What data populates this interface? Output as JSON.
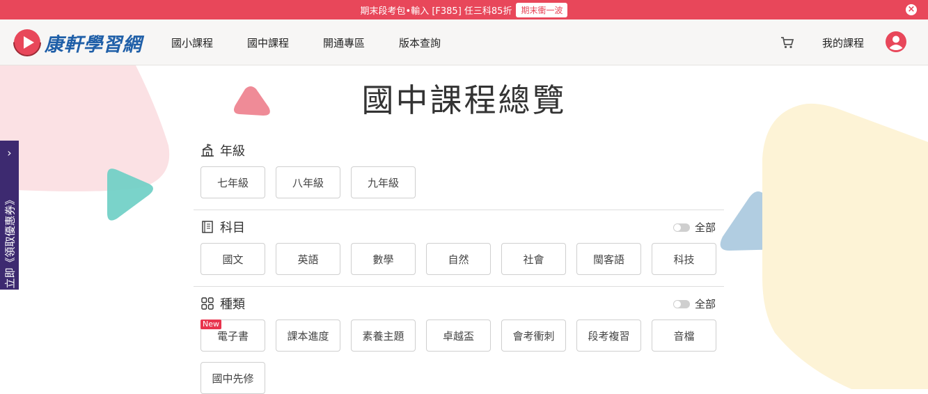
{
  "promo": {
    "text": "期末段考包•輸入 [F385] 任三科85折",
    "button": "期末衝一波"
  },
  "header": {
    "logo_text": "康軒學習網",
    "nav": [
      "國小課程",
      "國中課程",
      "開通專區",
      "版本查詢"
    ],
    "my_course": "我的課程"
  },
  "side_tab": {
    "text": "立即《領取優惠券》"
  },
  "page": {
    "title": "國中課程總覽"
  },
  "grade": {
    "label": "年級",
    "options": [
      "七年級",
      "八年級",
      "九年級"
    ]
  },
  "subject": {
    "label": "科目",
    "toggle_label": "全部",
    "options": [
      "國文",
      "英語",
      "數學",
      "自然",
      "社會",
      "閩客語",
      "科技"
    ]
  },
  "category": {
    "label": "種類",
    "toggle_label": "全部",
    "new_badge": "New",
    "options": [
      "電子書",
      "課本進度",
      "素養主題",
      "卓越盃",
      "會考衝刺",
      "段考複習",
      "音檔",
      "國中先修"
    ]
  },
  "colors": {
    "promo_bg": "#e8475a",
    "brand_blue": "#1f5fa8",
    "side_tab": "#3d2a70",
    "avatar": "#e8475a"
  },
  "icons": [
    "close-icon",
    "logo-play-icon",
    "cart-icon",
    "user-avatar-icon",
    "chevron-right-icon",
    "school-icon",
    "book-icon",
    "grid-icon"
  ]
}
